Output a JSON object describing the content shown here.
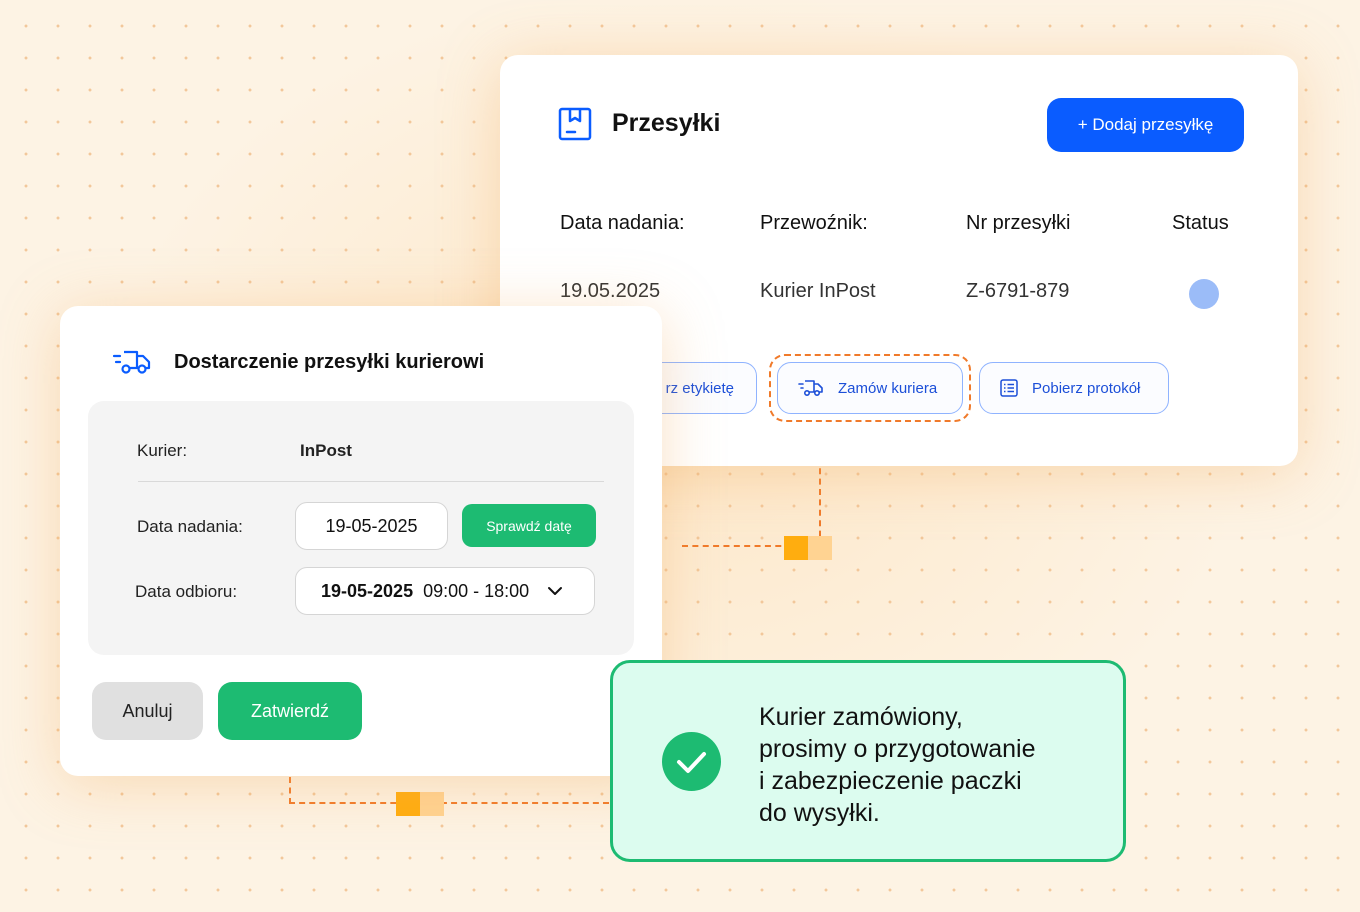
{
  "shipments": {
    "title": "Przesyłki",
    "add_button": "+ Dodaj przesyłkę",
    "columns": [
      "Data nadania:",
      "Przewoźnik:",
      "Nr przesyłki",
      "Status"
    ],
    "row": {
      "date": "19.05.2025",
      "carrier": "Kurier InPost",
      "number": "Z-6791-879",
      "status_color": "#9bbcf8"
    },
    "actions": {
      "label": "rz etykietę",
      "courier": "Zamów kuriera",
      "protocol": "Pobierz protokół"
    }
  },
  "dialog": {
    "title": "Dostarczenie przesyłki kurierowi",
    "courier_label": "Kurier:",
    "courier_value": "InPost",
    "send_date_label": "Data nadania:",
    "send_date_value": "19-05-2025",
    "check_button": "Sprawdź datę",
    "pickup_label": "Data odbioru:",
    "pickup_date": "19-05-2025",
    "pickup_time": "09:00 - 18:00",
    "cancel_button": "Anuluj",
    "confirm_button": "Zatwierdź"
  },
  "toast": {
    "lines": [
      "Kurier zamówiony,",
      "prosimy o przygotowanie",
      "i zabezpieczenie paczki",
      "do wysyłki."
    ]
  },
  "colors": {
    "primary": "#0a5cff",
    "success": "#1dbb72",
    "accent": "#f07a2a"
  }
}
